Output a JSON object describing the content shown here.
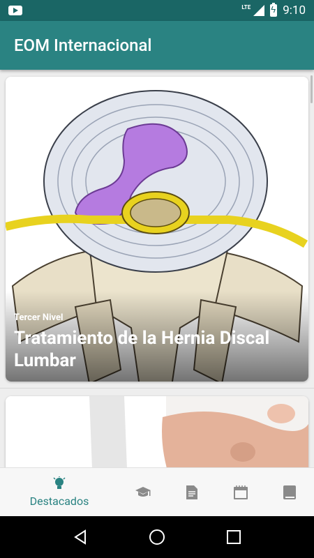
{
  "status_bar": {
    "network": "LTE",
    "time": "9:10",
    "icons": [
      "youtube-icon",
      "signal-icon",
      "battery-charging-icon"
    ]
  },
  "app_bar": {
    "title": "EOM Internacional"
  },
  "cards": [
    {
      "category": "Tercer Nivel",
      "title": "Tratamiento de la Hernia Discal Lumbar",
      "image": "lumbar-disc-herniation-illustration"
    },
    {
      "category": "",
      "title": "",
      "image": "doctor-hand-pointing-photo"
    }
  ],
  "bottom_nav": {
    "items": [
      {
        "label": "Destacados",
        "icon": "lightbulb-icon",
        "active": true
      },
      {
        "label": "",
        "icon": "graduation-cap-icon",
        "active": false
      },
      {
        "label": "",
        "icon": "document-icon",
        "active": false
      },
      {
        "label": "",
        "icon": "calendar-icon",
        "active": false
      },
      {
        "label": "",
        "icon": "book-icon",
        "active": false
      }
    ]
  },
  "system_nav": {
    "icons": [
      "back-icon",
      "home-icon",
      "recents-icon"
    ]
  },
  "colors": {
    "status_bar": "#1a6665",
    "app_bar": "#2a8382",
    "accent": "#2a8382",
    "inactive_icon": "#8a8a8a"
  }
}
